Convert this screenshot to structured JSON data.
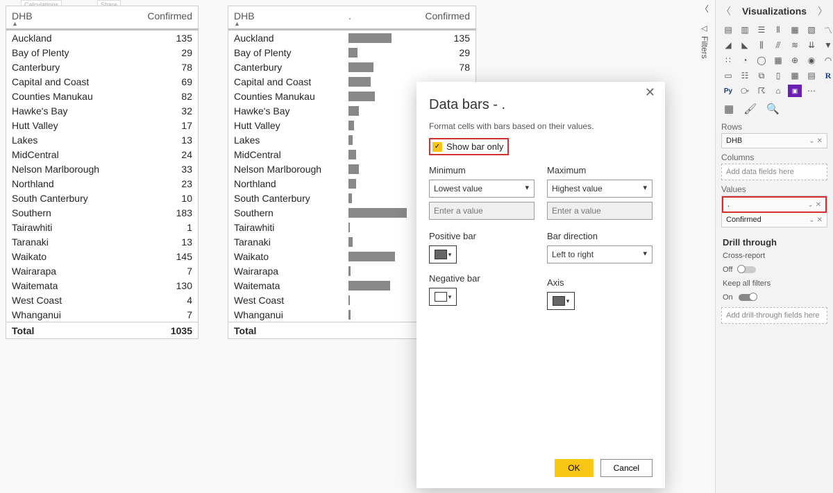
{
  "ribbon_faint": [
    "Calculations",
    "Share"
  ],
  "table": {
    "headers": {
      "dhb": "DHB",
      "dot": ".",
      "confirmed": "Confirmed"
    },
    "rows": [
      {
        "dhb": "Auckland",
        "confirmed": 135
      },
      {
        "dhb": "Bay of Plenty",
        "confirmed": 29
      },
      {
        "dhb": "Canterbury",
        "confirmed": 78
      },
      {
        "dhb": "Capital and Coast",
        "confirmed": 69
      },
      {
        "dhb": "Counties Manukau",
        "confirmed": 82
      },
      {
        "dhb": "Hawke's Bay",
        "confirmed": 32
      },
      {
        "dhb": "Hutt Valley",
        "confirmed": 17
      },
      {
        "dhb": "Lakes",
        "confirmed": 13
      },
      {
        "dhb": "MidCentral",
        "confirmed": 24
      },
      {
        "dhb": "Nelson Marlborough",
        "confirmed": 33
      },
      {
        "dhb": "Northland",
        "confirmed": 23
      },
      {
        "dhb": "South Canterbury",
        "confirmed": 10
      },
      {
        "dhb": "Southern",
        "confirmed": 183
      },
      {
        "dhb": "Tairawhiti",
        "confirmed": 1
      },
      {
        "dhb": "Taranaki",
        "confirmed": 13
      },
      {
        "dhb": "Waikato",
        "confirmed": 145
      },
      {
        "dhb": "Wairarapa",
        "confirmed": 7
      },
      {
        "dhb": "Waitemata",
        "confirmed": 130
      },
      {
        "dhb": "West Coast",
        "confirmed": 4
      },
      {
        "dhb": "Whanganui",
        "confirmed": 7
      }
    ],
    "total_label": "Total",
    "total_value": 1035,
    "max_value": 183,
    "visible_confirmed_rows": 3
  },
  "dialog": {
    "title": "Data bars - .",
    "desc": "Format cells with bars based on their values.",
    "show_bar_only": "Show bar only",
    "minimum": "Minimum",
    "maximum": "Maximum",
    "min_select": "Lowest value",
    "max_select": "Highest value",
    "value_placeholder": "Enter a value",
    "positive_bar": "Positive bar",
    "negative_bar": "Negative bar",
    "bar_direction": "Bar direction",
    "bar_direction_value": "Left to right",
    "axis": "Axis",
    "ok": "OK",
    "cancel": "Cancel"
  },
  "filters_tab": "Filters",
  "viz_panel": {
    "title": "Visualizations",
    "rows_label": "Rows",
    "rows_value": "DHB",
    "columns_label": "Columns",
    "columns_placeholder": "Add data fields here",
    "values_label": "Values",
    "values_items": [
      ".",
      "Confirmed"
    ],
    "drill_through": "Drill through",
    "cross_report": "Cross-report",
    "off": "Off",
    "keep_filters": "Keep all filters",
    "on": "On",
    "drill_placeholder": "Add drill-through fields here"
  },
  "chart_data": {
    "type": "table",
    "columns": [
      "DHB",
      "Confirmed"
    ],
    "rows": [
      [
        "Auckland",
        135
      ],
      [
        "Bay of Plenty",
        29
      ],
      [
        "Canterbury",
        78
      ],
      [
        "Capital and Coast",
        69
      ],
      [
        "Counties Manukau",
        82
      ],
      [
        "Hawke's Bay",
        32
      ],
      [
        "Hutt Valley",
        17
      ],
      [
        "Lakes",
        13
      ],
      [
        "MidCentral",
        24
      ],
      [
        "Nelson Marlborough",
        33
      ],
      [
        "Northland",
        23
      ],
      [
        "South Canterbury",
        10
      ],
      [
        "Southern",
        183
      ],
      [
        "Tairawhiti",
        1
      ],
      [
        "Taranaki",
        13
      ],
      [
        "Waikato",
        145
      ],
      [
        "Wairarapa",
        7
      ],
      [
        "Waitemata",
        130
      ],
      [
        "West Coast",
        4
      ],
      [
        "Whanganui",
        7
      ]
    ],
    "total": [
      "Total",
      1035
    ]
  }
}
